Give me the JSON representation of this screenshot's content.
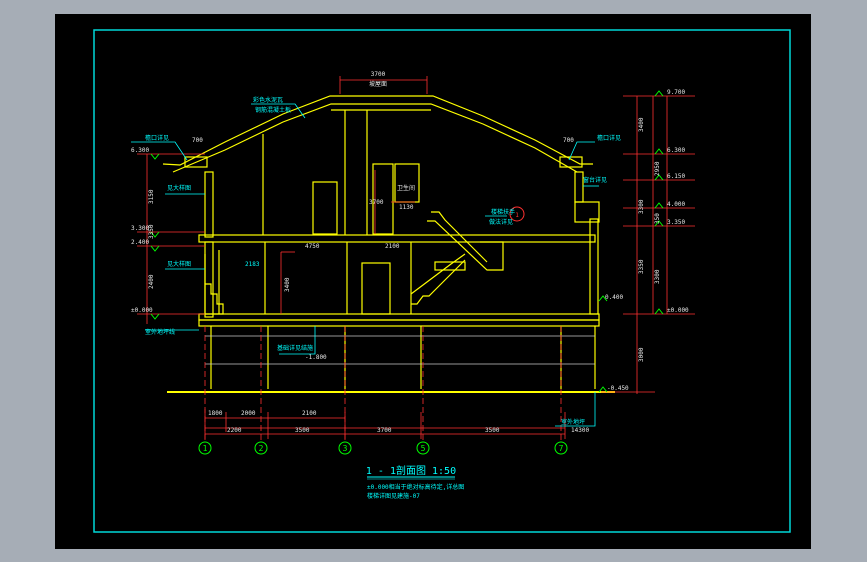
{
  "colors": {
    "background": "#a6adb6",
    "sheet": "#000000",
    "frame": "#00d8d8",
    "walls": "#ffff00",
    "dims": "#ff3030",
    "text_dims": "#e8e8e8",
    "text_notes": "#00ffff",
    "axis_marks": "#00ff00",
    "elev_marks": "#00ff00"
  },
  "drawing": {
    "title": "1 - 1剖面图 1:50",
    "note_line1": "±0.000相当于绝对标高待定,详总图",
    "note_line2": "楼梯详图见建施-07",
    "ridge_dim": "3700",
    "ridge_label": "坡屋面",
    "roof_label_a": "彩色水泥瓦",
    "roof_label_b": "钢筋混凝土板",
    "eave_left_label": "檐口详见",
    "eave_right_label": "檐口详见",
    "eave_left_dim": "700",
    "eave_right_dim": "700",
    "left_elevations": [
      "6.300",
      "3.300",
      "2.400",
      "±0.000"
    ],
    "left_vert_dims": [
      "3150",
      "3350",
      "2400"
    ],
    "left_notes": [
      "见大样图",
      "见大样图",
      "室外地坪线"
    ],
    "right_elevations": [
      "9.700",
      "6.300",
      "6.150",
      "4.000",
      "3.350",
      "0.400",
      "±0.000",
      "-0.450"
    ],
    "right_vert_dims": [
      "3400",
      "2950",
      "3300",
      "3350",
      "350",
      "3300",
      "3000"
    ],
    "floor_dims": [
      "4750",
      "2100",
      "3700"
    ],
    "interior_dims": [
      "2383",
      "2183",
      "3400",
      "2700",
      "1130"
    ],
    "room_labels": [
      "卫生间",
      "储藏室"
    ],
    "basement_note": "基础详见结施",
    "basement_elev": "-1.800",
    "stair_note_a": "楼梯扶手",
    "stair_note_b": "做法详见",
    "right_note": "窗台详见",
    "bottom_right_note": "室外地坪",
    "bottom_dims_row1": [
      "1800",
      "2000",
      "2100"
    ],
    "bottom_dims_row2": [
      "2200",
      "3500",
      "3700",
      "3500"
    ],
    "total_dim": "14300",
    "grid_axes": [
      "1",
      "2",
      "3",
      "5",
      "7"
    ],
    "callout_mark": "1"
  }
}
